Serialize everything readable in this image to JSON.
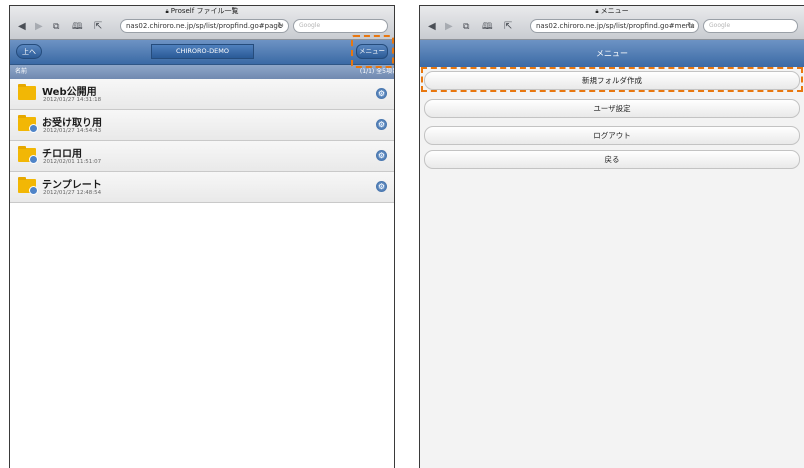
{
  "left": {
    "browser": {
      "page_title": "Proself ファイル一覧",
      "url": "nas02.chiroro.ne.jp/sp/list/propfind.go#page",
      "search_placeholder": "Google"
    },
    "header": {
      "up_button": "上へ",
      "title": "CHIRORO-DEMO",
      "menu_button": "メニュー"
    },
    "column_bar": {
      "name_label": "名前",
      "count_label": "(1/1) 全5項目"
    },
    "files": [
      {
        "title": "Web公開用",
        "date": "2012/01/27 14:31:18",
        "badge": false
      },
      {
        "title": "お受け取り用",
        "date": "2012/01/27 14:54:43",
        "badge": true
      },
      {
        "title": "チロロ用",
        "date": "2012/02/01 11:51:07",
        "badge": true
      },
      {
        "title": "テンプレート",
        "date": "2012/01/27 12:48:54",
        "badge": true
      }
    ]
  },
  "right": {
    "browser": {
      "page_title": "メニュー",
      "url": "nas02.chiroro.ne.jp/sp/list/propfind.go#menu",
      "search_placeholder": "Google"
    },
    "header": {
      "title": "メニュー"
    },
    "menu_items": [
      "新規フォルダ作成",
      "ユーザ設定",
      "ログアウト",
      "戻る"
    ]
  },
  "colors": {
    "highlight": "#e8770f",
    "header_blue": "#3b6aa5",
    "folder_yellow": "#f2b705"
  },
  "icons": [
    "back-arrow-icon",
    "forward-arrow-icon",
    "tabs-icon",
    "bookmarks-icon",
    "share-icon",
    "reload-icon",
    "lock-icon",
    "folder-icon",
    "gear-icon"
  ]
}
